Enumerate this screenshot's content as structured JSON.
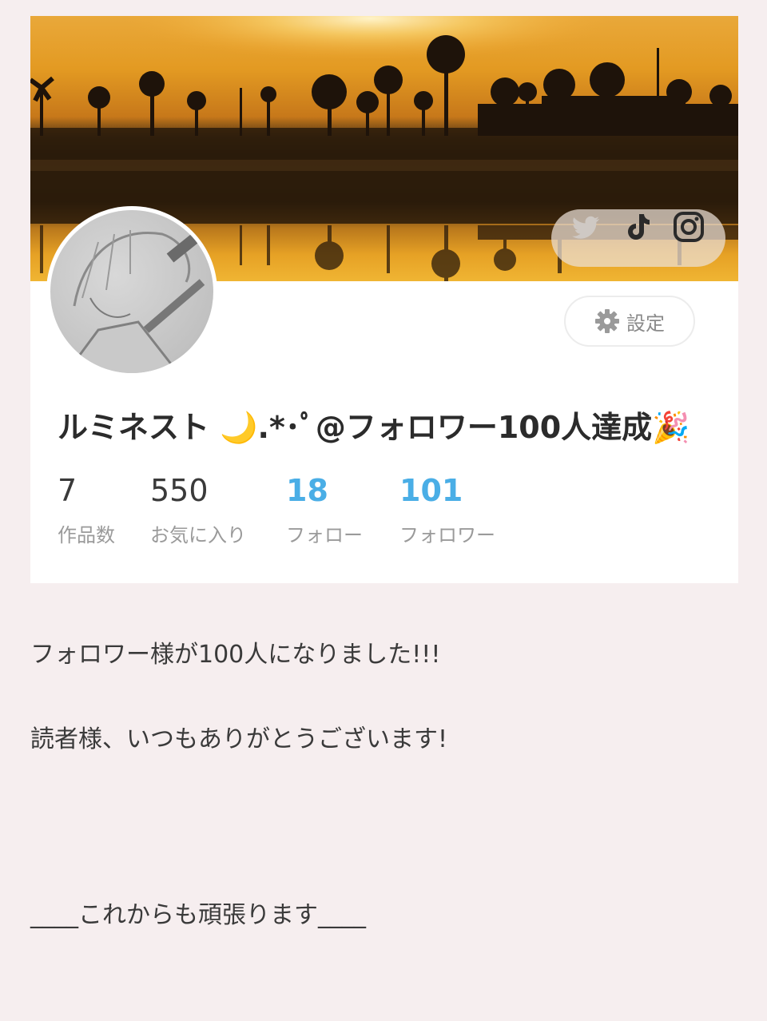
{
  "profile": {
    "username": "ルミネスト 🌙.*･ﾟ@フォロワー100人達成🎉",
    "settings_label": "設定",
    "social": [
      "twitter-icon",
      "tiktok-icon",
      "instagram-icon"
    ]
  },
  "stats": [
    {
      "value": "7",
      "label": "作品数"
    },
    {
      "value": "550",
      "label": "お気に入り"
    },
    {
      "value": "18",
      "label": "フォロー"
    },
    {
      "value": "101",
      "label": "フォロワー"
    }
  ],
  "post": {
    "line1": "フォロワー様が100人になりました!!!",
    "line2": "読者様、いつもありがとうございます!",
    "line3": "____これからも頑張ります____"
  },
  "colors": {
    "background": "#f6eeef",
    "link_blue": "#4aaee6",
    "text": "#3a3a3a"
  }
}
